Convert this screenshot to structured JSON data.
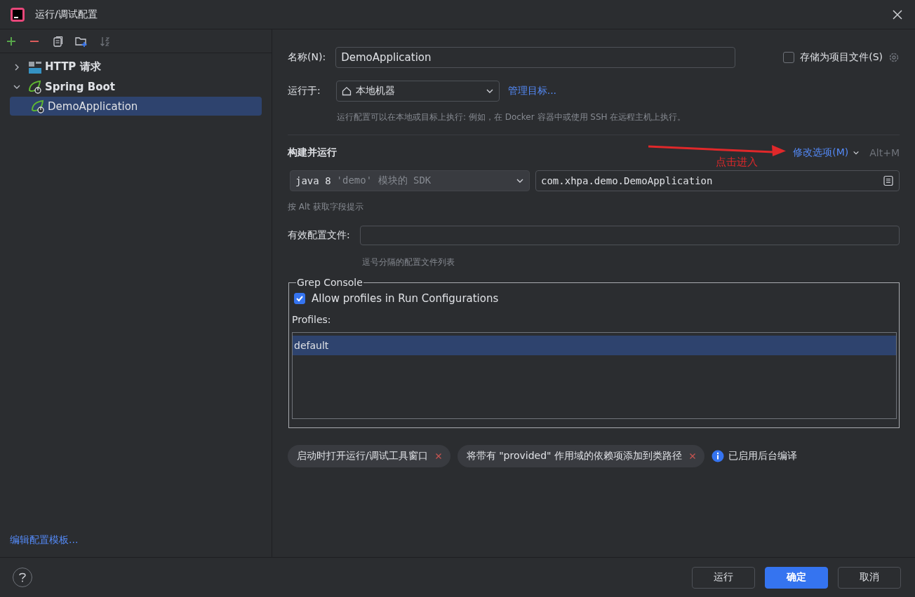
{
  "window": {
    "title": "运行/调试配置"
  },
  "tree": [
    {
      "label": "HTTP 请求",
      "kind": "http",
      "expanded": false,
      "selected": false
    },
    {
      "label": "Spring Boot",
      "kind": "spring",
      "expanded": true,
      "selected": false,
      "children": [
        {
          "label": "DemoApplication",
          "kind": "spring",
          "selected": true
        }
      ]
    }
  ],
  "edit_templates_link": "编辑配置模板...",
  "form": {
    "name_label": "名称(N):",
    "name_value": "DemoApplication",
    "store_checkbox": {
      "label": "存储为项目文件(S)",
      "checked": false
    },
    "run_on_label": "运行于:",
    "run_on_value": "本地机器",
    "manage_targets_link": "管理目标...",
    "run_on_hint": "运行配置可以在本地或目标上执行: 例如，在 Docker 容器中或使用 SSH 在远程主机上执行。",
    "section_title": "构建并运行",
    "modify_options_link": "修改选项(M)",
    "modify_shortcut": "Alt+M",
    "annotation": "点击进入",
    "sdk_value": "java 8",
    "sdk_detail": "'demo' 模块的 SDK",
    "main_class": "com.xhpa.demo.DemoApplication",
    "field_hint": "按 Alt 获取字段提示",
    "active_profiles_label": "有效配置文件:",
    "active_profiles_hint": "逗号分隔的配置文件列表"
  },
  "grep_console": {
    "title": "Grep Console",
    "checkbox": {
      "label": "Allow profiles in Run Configurations",
      "checked": true
    },
    "profiles_label": "Profiles:",
    "profiles": [
      {
        "label": "default",
        "selected": true
      }
    ]
  },
  "tags": [
    {
      "label": "启动时打开运行/调试工具窗口"
    },
    {
      "label": "将带有 \"provided\" 作用域的依赖项添加到类路径"
    }
  ],
  "info": "已启用后台编译",
  "buttons": [
    {
      "label": "运行",
      "kind": "secondary"
    },
    {
      "label": "确定",
      "kind": "primary"
    },
    {
      "label": "取消",
      "kind": "secondary"
    }
  ]
}
